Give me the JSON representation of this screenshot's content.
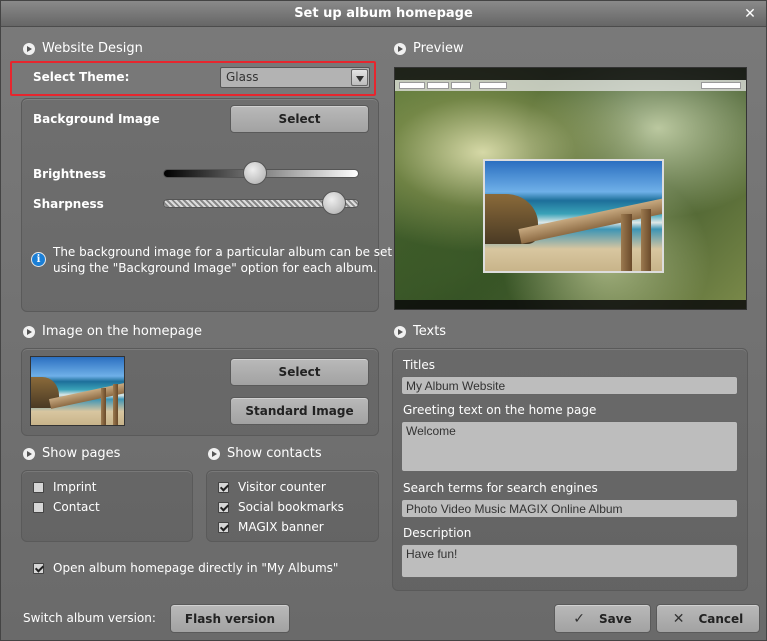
{
  "dialog": {
    "title": "Set up album homepage",
    "close_glyph": "✕"
  },
  "website_design": {
    "heading": "Website Design",
    "select_theme_label": "Select Theme:",
    "theme_value": "Glass",
    "background_image_label": "Background Image",
    "background_select_button": "Select",
    "brightness_label": "Brightness",
    "brightness_value": 0.47,
    "sharpness_label": "Sharpness",
    "sharpness_value": 0.87,
    "info_text_line1": "The background image for a particular album can be set",
    "info_text_line2": "using the \"Background Image\" option for each album."
  },
  "preview": {
    "heading": "Preview"
  },
  "image_on_homepage": {
    "heading": "Image on the homepage",
    "select_button": "Select",
    "standard_button": "Standard Image"
  },
  "show_pages": {
    "heading": "Show pages",
    "items": [
      {
        "label": "Imprint",
        "checked": false
      },
      {
        "label": "Contact",
        "checked": false
      }
    ]
  },
  "show_contacts": {
    "heading": "Show contacts",
    "items": [
      {
        "label": "Visitor counter",
        "checked": true
      },
      {
        "label": "Social bookmarks",
        "checked": true
      },
      {
        "label": "MAGIX banner",
        "checked": true
      }
    ]
  },
  "open_directly": {
    "label": "Open album homepage directly in \"My Albums\"",
    "checked": true
  },
  "texts": {
    "heading": "Texts",
    "titles_label": "Titles",
    "titles_value": "My Album Website",
    "greeting_label": "Greeting text on the home page",
    "greeting_value": "Welcome",
    "search_label": "Search terms for search engines",
    "search_value": "Photo Video Music MAGIX Online Album",
    "description_label": "Description",
    "description_value": "Have fun!"
  },
  "footer": {
    "switch_label": "Switch album version:",
    "flash_button": "Flash version",
    "save_button": "Save",
    "save_icon": "✓",
    "cancel_button": "Cancel",
    "cancel_icon": "✕"
  },
  "colors": {
    "highlight_border": "#e6262e",
    "info_icon": "#1b7fd6"
  }
}
